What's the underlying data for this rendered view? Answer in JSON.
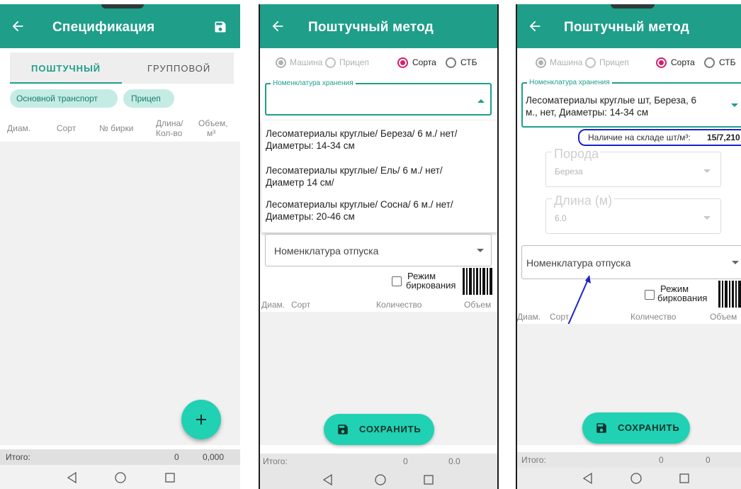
{
  "screen1": {
    "title": "Спецификация",
    "tabs": [
      "ПОШТУЧНЫЙ",
      "ГРУППОВОЙ"
    ],
    "chips": [
      "Основной транспорт",
      "Прицеп"
    ],
    "columns": [
      "Диам.",
      "Сорт",
      "№ бирки",
      "Длина/",
      "Кол-во",
      "Объем,",
      "м³"
    ],
    "totals_label": "Итого:",
    "totals_count": "0",
    "totals_volume": "0,000"
  },
  "screen2": {
    "title": "Поштучный метод",
    "radios": [
      "Машина",
      "Прицеп",
      "Сорта",
      "СТБ"
    ],
    "storage_legend": "Номенклатура хранения",
    "options": [
      {
        "line1": "Лесоматериалы круглые/ Береза/ 6 м./  нет/",
        "line2": "Диаметры: 14-34 см"
      },
      {
        "line1": "Лесоматериалы круглые/ Ель/ 6 м./  нет/",
        "line2": "Диаметр 14 см/"
      },
      {
        "line1": "Лесоматериалы круглые/ Сосна/ 6 м./  нет/",
        "line2": "Диаметры: 20-46 см"
      }
    ],
    "release_label": "Номенклатура отпуска",
    "mode_label_1": "Режим",
    "mode_label_2": "биркования",
    "columns": [
      "Диам.",
      "Сорт",
      "Количество",
      "Объем"
    ],
    "save_label": "СОХРАНИТЬ",
    "totals_label": "Итого:",
    "totals_count": "0",
    "totals_volume": "0.0"
  },
  "screen3": {
    "title": "Поштучный метод",
    "radios": [
      "Машина",
      "Прицеп",
      "Сорта",
      "СТБ"
    ],
    "storage_legend": "Номенклатура хранения",
    "storage_value_1": "Лесоматериалы круглые шт, Береза, 6",
    "storage_value_2": "м., нет, Диаметры: 14-34 см",
    "stock_label": "Наличие на складе шт/м³:",
    "stock_value": "15/7,210",
    "breed_label": "Порода",
    "breed_value": "Береза",
    "length_label": "Длина (м)",
    "length_value": "6.0",
    "release_label": "Номенклатура отпуска",
    "mode_label_1": "Режим",
    "mode_label_2": "биркования",
    "columns": [
      "Диам.",
      "Сорт",
      "Количество",
      "Объем"
    ],
    "save_label": "СОХРАНИТЬ",
    "totals_label": "Итого:",
    "totals_count": "0",
    "totals_volume": "0"
  },
  "colors": {
    "primary": "#1f9e8a",
    "accent": "#21d1b3",
    "radio": "#d3206a",
    "annotation": "#1a23c9"
  },
  "icons": [
    "back-arrow-icon",
    "save-icon",
    "add-icon",
    "dropdown-arrow-icon",
    "barcode-icon",
    "nav-back-icon",
    "nav-home-icon",
    "nav-recents-icon"
  ]
}
